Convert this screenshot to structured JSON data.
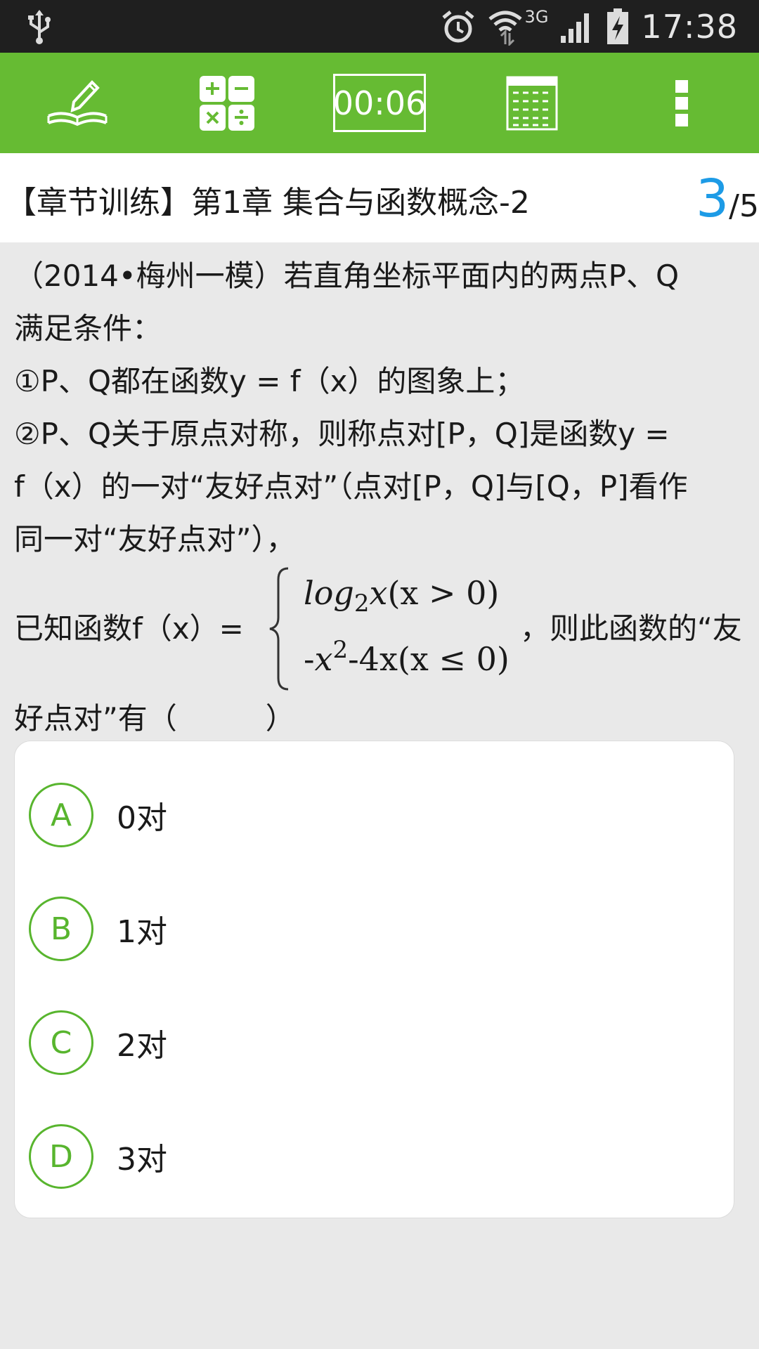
{
  "status_bar": {
    "network": "3G",
    "time": "17:38",
    "icons": [
      "usb-icon",
      "alarm-icon",
      "wifi-icon",
      "signal-icon",
      "battery-charging-icon"
    ]
  },
  "toolbar": {
    "background": "#66bb33",
    "buttons": [
      "notes-icon",
      "calculator-icon",
      "answer-sheet-icon",
      "more-icon"
    ],
    "timer": "00:06"
  },
  "header": {
    "title": "【章节训练】第1章 集合与函数概念-2",
    "current": "3",
    "total": "/5",
    "accent": "#1d9be6"
  },
  "question": {
    "lines": [
      "（2014•梅州一模）若直角坐标平面内的两点P、Q",
      "满足条件：",
      "①P、Q都在函数y = f（x）的图象上；",
      "②P、Q关于原点对称，则称点对[P，Q]是函数y =",
      "f（x）的一对“友好点对”（点对[P，Q]与[Q，P]看作",
      "同一对“友好点对”），"
    ],
    "formula_lead": "已知函数f（x）=",
    "formula_trail": "，则此函数的“友",
    "piecewise": {
      "case1_fn": "log",
      "case1_base": "2",
      "case1_arg": "x",
      "case1_cond": "(x > 0)",
      "case2_neg": "-",
      "case2_var": "x",
      "case2_exp": "2",
      "case2_rest": "-4x",
      "case2_cond": "(x ≤ 0)"
    },
    "last_line": "好点对”有（　　　）"
  },
  "options": [
    {
      "letter": "A",
      "text": "0对"
    },
    {
      "letter": "B",
      "text": "1对"
    },
    {
      "letter": "C",
      "text": "2对"
    },
    {
      "letter": "D",
      "text": "3对"
    }
  ],
  "colors": {
    "option_accent": "#58b52e",
    "page_background": "#e9e9e9",
    "status_bar": "#1f1f1f"
  }
}
